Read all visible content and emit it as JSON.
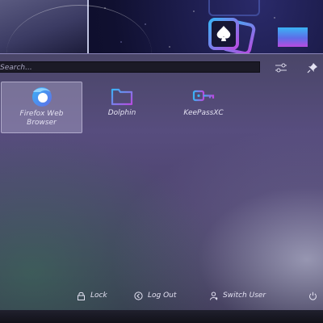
{
  "search": {
    "placeholder": "Search..."
  },
  "apps": [
    {
      "label": "Firefox Web Browser",
      "icon": "firefox-icon"
    },
    {
      "label": "Dolphin",
      "icon": "folder-icon"
    },
    {
      "label": "KeePassXC",
      "icon": "key-icon"
    }
  ],
  "footer": {
    "lock_label": "Lock",
    "logout_label": "Log Out",
    "switch_user_label": "Switch User"
  },
  "colors": {
    "accent_blue": "#3ab3f5",
    "accent_purple": "#b84be0",
    "panel_bg": "#4a4668",
    "search_bg": "#1b1a26"
  }
}
